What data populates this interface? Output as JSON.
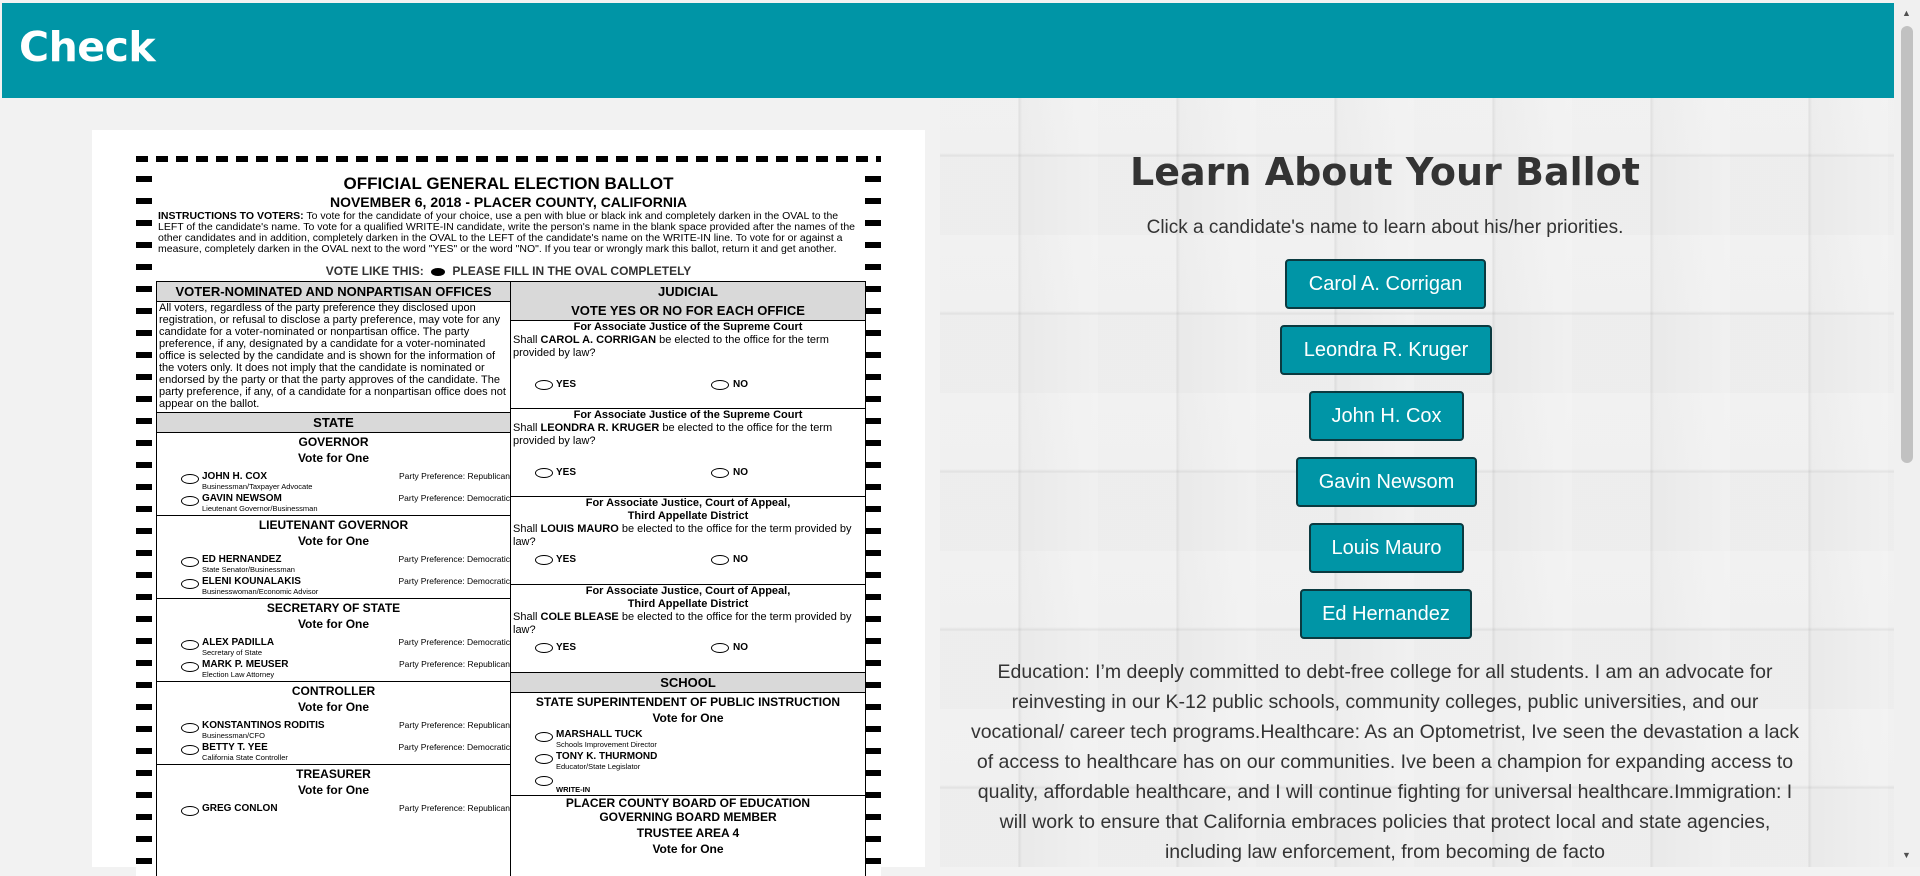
{
  "header": {
    "title": "Check"
  },
  "ballot": {
    "title": "OFFICIAL GENERAL ELECTION BALLOT",
    "date_line": "NOVEMBER 6, 2018 - PLACER COUNTY, CALIFORNIA",
    "instructions_label": "INSTRUCTIONS TO VOTERS:",
    "instructions": "To vote for the candidate of your choice, use a pen with blue or black ink and completely darken in the OVAL to the LEFT of the candidate's name. To vote for a qualified WRITE-IN candidate, write the person's name in the blank space provided after the names of the other candidates and in addition, completely darken in the OVAL to the LEFT of the candidate's name on the WRITE-IN line. To vote for or against a measure, completely darken in the OVAL next to the word \"YES\" or the word \"NO\". If you tear or wrongly mark this ballot, return it and get another.",
    "vote_like_this": "VOTE LIKE THIS:",
    "fill_oval": "PLEASE FILL IN THE OVAL COMPLETELY",
    "left": {
      "section_title": "VOTER-NOMINATED AND NONPARTISAN OFFICES",
      "section_text": "All voters, regardless of the party preference they disclosed upon registration, or refusal to disclose a party preference, may vote for any candidate for a voter-nominated or nonpartisan office. The party preference, if any, designated by a candidate for a voter-nominated office is selected by the candidate and is shown for the information of the voters only. It does not imply that the candidate is nominated or endorsed by the party or that the party approves of the candidate. The party preference, if any, of a candidate for a nonpartisan office does not appear on the ballot.",
      "state_label": "STATE",
      "offices": [
        {
          "title": "GOVERNOR",
          "vote_for": "Vote for One",
          "candidates": [
            {
              "name": "JOHN H. COX",
              "occupation": "Businessman/Taxpayer Advocate",
              "party": "Party Preference: Republican"
            },
            {
              "name": "GAVIN NEWSOM",
              "occupation": "Lieutenant Governor/Businessman",
              "party": "Party Preference: Democratic"
            }
          ]
        },
        {
          "title": "LIEUTENANT GOVERNOR",
          "vote_for": "Vote for One",
          "candidates": [
            {
              "name": "ED HERNANDEZ",
              "occupation": "State Senator/Businessman",
              "party": "Party Preference: Democratic"
            },
            {
              "name": "ELENI KOUNALAKIS",
              "occupation": "Businesswoman/Economic Advisor",
              "party": "Party Preference: Democratic"
            }
          ]
        },
        {
          "title": "SECRETARY OF STATE",
          "vote_for": "Vote for One",
          "candidates": [
            {
              "name": "ALEX PADILLA",
              "occupation": "Secretary of State",
              "party": "Party Preference: Democratic"
            },
            {
              "name": "MARK P. MEUSER",
              "occupation": "Election Law Attorney",
              "party": "Party Preference: Republican"
            }
          ]
        },
        {
          "title": "CONTROLLER",
          "vote_for": "Vote for One",
          "candidates": [
            {
              "name": "KONSTANTINOS RODITIS",
              "occupation": "Businessman/CFO",
              "party": "Party Preference: Republican"
            },
            {
              "name": "BETTY T. YEE",
              "occupation": "California State Controller",
              "party": "Party Preference: Democratic"
            }
          ]
        },
        {
          "title": "TREASURER",
          "vote_for": "Vote for One",
          "candidates": [
            {
              "name": "GREG CONLON",
              "occupation": "",
              "party": "Party Preference: Republican"
            }
          ]
        }
      ]
    },
    "right": {
      "section_title": "JUDICIAL",
      "section_sub": "VOTE YES OR NO FOR EACH OFFICE",
      "yes": "YES",
      "no": "NO",
      "measures": [
        {
          "title": "For Associate Justice of the Supreme Court",
          "prefix": "Shall",
          "name": "CAROL A. CORRIGAN",
          "suffix": "be elected to the office for the term provided by law?"
        },
        {
          "title": "For Associate Justice of the Supreme Court",
          "prefix": "Shall",
          "name": "LEONDRA R. KRUGER",
          "suffix": "be elected to the office for the term provided by law?"
        },
        {
          "title": "For Associate Justice, Court of Appeal, Third Appellate District",
          "prefix": "Shall",
          "name": "LOUIS MAURO",
          "suffix": "be elected to the office for the term provided by law?"
        },
        {
          "title": "For Associate Justice, Court of Appeal, Third Appellate District",
          "prefix": "Shall",
          "name": "COLE BLEASE",
          "suffix": "be elected to the office for the term provided by law?"
        }
      ],
      "school_label": "SCHOOL",
      "superintendent": {
        "title": "STATE SUPERINTENDENT OF PUBLIC INSTRUCTION",
        "vote_for": "Vote for One",
        "candidates": [
          {
            "name": "MARSHALL TUCK",
            "occupation": "Schools Improvement Director"
          },
          {
            "name": "TONY K. THURMOND",
            "occupation": "Educator/State Legislator"
          }
        ],
        "write_in": "WRITE-IN"
      },
      "board": {
        "title": "PLACER COUNTY BOARD OF EDUCATION GOVERNING BOARD MEMBER",
        "area": "TRUSTEE AREA 4",
        "vote_for": "Vote for One"
      }
    }
  },
  "learn": {
    "title": "Learn About Your Ballot",
    "subtitle": "Click a candidate's name to learn about his/her priorities.",
    "candidates": [
      "Carol A. Corrigan",
      "Leondra R. Kruger",
      "John H. Cox",
      "Gavin Newsom",
      "Louis Mauro",
      "Ed Hernandez"
    ],
    "bio": "Education: I’m deeply committed to debt-free college for all students. I am an advocate for reinvesting in our K-12 public schools, community colleges, public universities, and our vocational/ career tech programs.Healthcare: As an Optometrist, Ive seen the devastation a lack of access to healthcare has on our communities. Ive been a champion for expanding access to quality, affordable healthcare, and I will continue fighting for universal healthcare.Immigration: I will work to ensure that California embraces policies that protect local and state agencies, including law enforcement, from becoming de facto"
  },
  "colors": {
    "accent": "#0095a6",
    "button_border": "#0b3a40",
    "text": "#333333"
  }
}
